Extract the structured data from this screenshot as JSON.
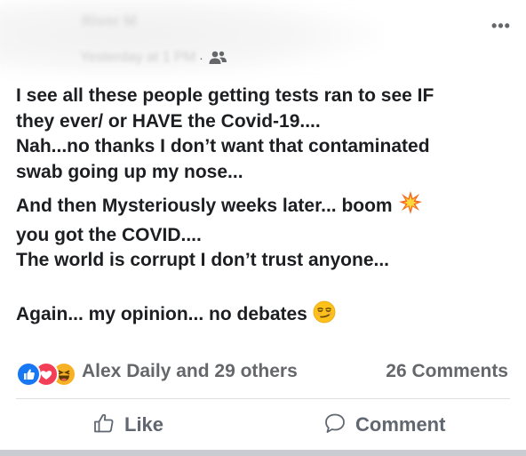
{
  "post": {
    "author_name": "River M",
    "timestamp": "Yesterday at 1 PM",
    "meta_separator": "·",
    "audience_icon": "friends-icon",
    "more_label": "•••",
    "body_lines": [
      "I see all these people getting tests ran to see IF",
      "they ever/ or HAVE the Covid-19....",
      "Nah...no thanks I don’t want that contaminated",
      "swab going up my nose...",
      "And then Mysteriously weeks later... boom",
      "you got the COVID....",
      "The world is corrupt I don’t trust anyone...",
      "Again... my opinion... no debates"
    ],
    "inline_emojis": [
      "collision-emoji",
      "smirking-face-emoji"
    ]
  },
  "reactions": {
    "icons": [
      "like-reaction-icon",
      "love-reaction-icon",
      "haha-reaction-icon"
    ],
    "summary": "Alex Daily and 29 others",
    "comments": "26 Comments"
  },
  "actions": {
    "like_label": "Like",
    "comment_label": "Comment"
  },
  "colors": {
    "text": "#1c1e21",
    "secondary": "#65676b",
    "like_blue": "#1877f2",
    "love_red": "#f33e58",
    "haha_yellow": "#f7b125",
    "divider": "#dddfe2"
  }
}
